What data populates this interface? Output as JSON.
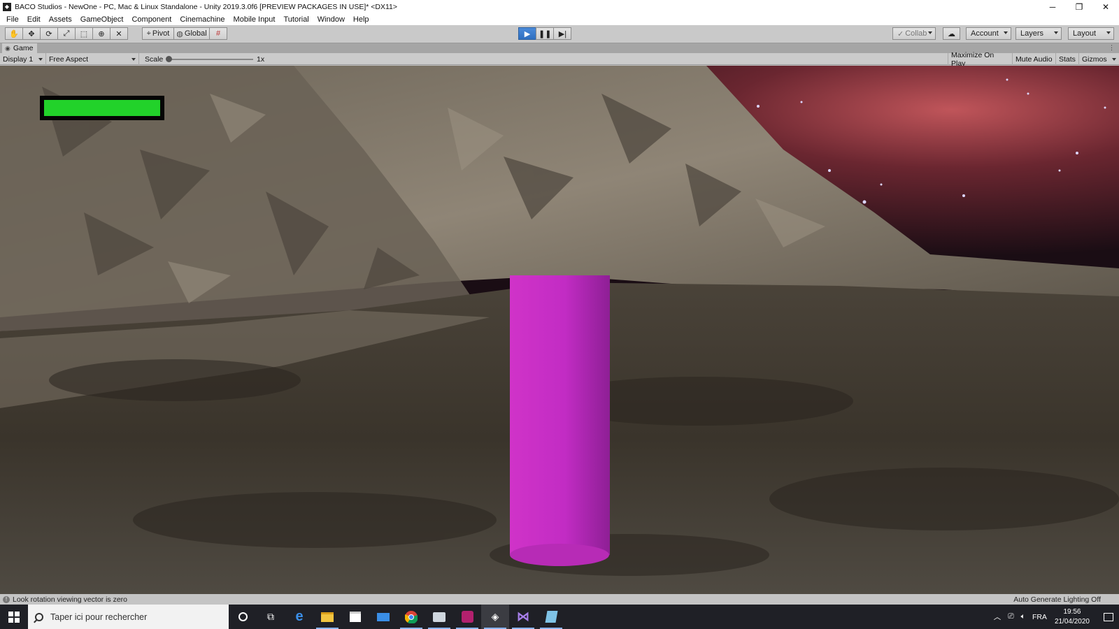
{
  "window": {
    "title": "BACO Studios - NewOne - PC, Mac & Linux Standalone - Unity 2019.3.0f6 [PREVIEW PACKAGES IN USE]* <DX11>",
    "minimize": "─",
    "restore": "❐",
    "close": "✕"
  },
  "menu": [
    "File",
    "Edit",
    "Assets",
    "GameObject",
    "Component",
    "Cinemachine",
    "Mobile Input",
    "Tutorial",
    "Window",
    "Help"
  ],
  "toolbar": {
    "pivot": "Pivot",
    "global": "Global",
    "collab": "Collab",
    "account": "Account",
    "layers": "Layers",
    "layout": "Layout"
  },
  "game_tab": {
    "label": "Game"
  },
  "game_toolbar": {
    "display": "Display 1",
    "aspect": "Free Aspect",
    "scale_label": "Scale",
    "scale_value": "1x",
    "maximize": "Maximize On Play",
    "mute": "Mute Audio",
    "stats": "Stats",
    "gizmos": "Gizmos"
  },
  "game": {
    "health_fraction": 1.0,
    "health_color": "#22d22a",
    "cylinder_color": "#c22cc4"
  },
  "status": {
    "message": "Look rotation viewing vector is zero",
    "lighting": "Auto Generate Lighting Off"
  },
  "taskbar": {
    "search_placeholder": "Taper ici pour rechercher",
    "language": "FRA",
    "time": "19:56",
    "date": "21/04/2020"
  }
}
